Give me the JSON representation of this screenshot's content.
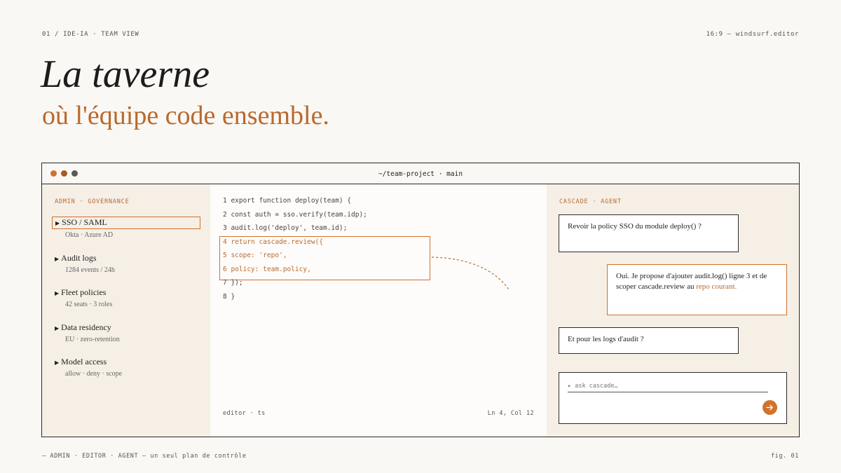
{
  "header": {
    "left": "01 / IDE-IA · TEAM VIEW",
    "right": "16:9 — windsurf.editor"
  },
  "hero": {
    "title": "La taverne",
    "subtitle": "où l'équipe code ensemble."
  },
  "window": {
    "title": "~/team-project · main",
    "dots": [
      "#d0722d",
      "#a65a25",
      "#5b5b55"
    ]
  },
  "admin": {
    "label": "ADMIN · GOVERNANCE",
    "items": [
      {
        "name": "SSO / SAML",
        "meta": "Okta · Azure AD"
      },
      {
        "name": "Audit logs",
        "meta": "1284 events / 24h"
      },
      {
        "name": "Fleet policies",
        "meta": "42 seats · 3 roles"
      },
      {
        "name": "Data residency",
        "meta": "EU · zero-retention"
      },
      {
        "name": "Model access",
        "meta": "allow · deny · scope"
      }
    ]
  },
  "editor": {
    "lines": [
      "1 export function deploy(team) {",
      "2 const auth = sso.verify(team.idp);",
      "3 audit.log('deploy', team.id);",
      "4 return cascade.review({",
      "5 scope: 'repo',",
      "6 policy: team.policy,",
      "7 });",
      "8 }"
    ],
    "footer_left": "editor · ts",
    "footer_right": "Ln 4, Col 12"
  },
  "agent": {
    "label": "CASCADE · AGENT",
    "messages": {
      "m1": "Revoir la policy SSO du module deploy() ?",
      "m2_main": "Oui. Je propose d'ajouter audit.log() ligne 3 et de scoper cascade.review au",
      "m2_accent": "repo courant.",
      "m3": "Et pour les logs d'audit ?"
    },
    "input_placeholder": "▸ ask cascade…"
  },
  "footer": {
    "left": "— ADMIN · EDITOR · AGENT — un seul plan de contrôle",
    "right": "fig. 01"
  },
  "colors": {
    "accent": "#d0722d",
    "accent_text": "#b8692e",
    "panel_bg": "#f5efe6",
    "page_bg": "#faf8f4"
  }
}
